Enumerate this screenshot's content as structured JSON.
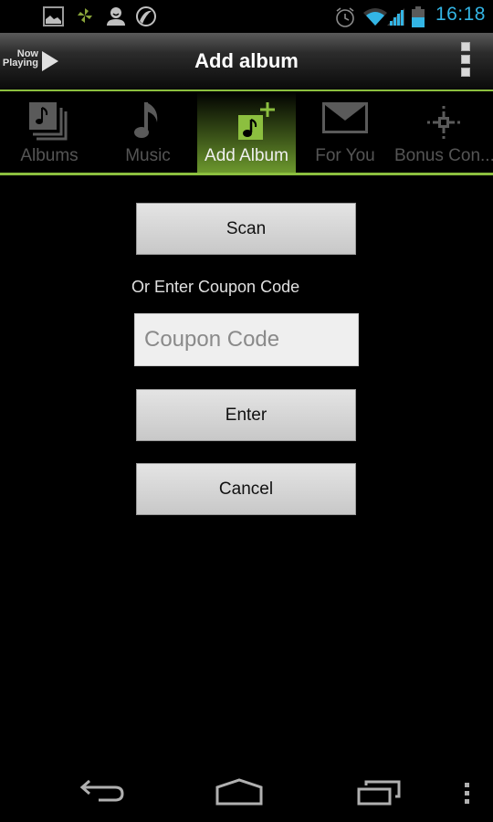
{
  "status_bar": {
    "left_icons": [
      "gallery-icon",
      "pinwheel-icon",
      "user-icon",
      "sync-icon"
    ],
    "right_icons": [
      "alarm-icon",
      "wifi-icon",
      "signal-icon",
      "battery-icon"
    ],
    "time": "16:18",
    "accent_color": "#33b5e5"
  },
  "action_bar": {
    "now_playing_line1": "Now",
    "now_playing_line2": "Playing",
    "title": "Add album",
    "accent_color": "#8cbf3f"
  },
  "tabs": [
    {
      "label": "Albums",
      "icon": "albums-icon",
      "active": false
    },
    {
      "label": "Music",
      "icon": "music-note-icon",
      "active": false
    },
    {
      "label": "Add Album",
      "icon": "add-album-icon",
      "active": true
    },
    {
      "label": "For You",
      "icon": "envelope-icon",
      "active": false
    },
    {
      "label": "Bonus Con...",
      "icon": "bonus-sparkle-icon",
      "active": false
    }
  ],
  "content": {
    "scan_label": "Scan",
    "coupon_prompt": "Or Enter Coupon Code",
    "coupon_value": "",
    "coupon_placeholder": "Coupon Code",
    "enter_label": "Enter",
    "cancel_label": "Cancel"
  },
  "nav_bar": {
    "buttons": [
      "back-icon",
      "home-icon",
      "recent-apps-icon",
      "menu-icon"
    ]
  }
}
